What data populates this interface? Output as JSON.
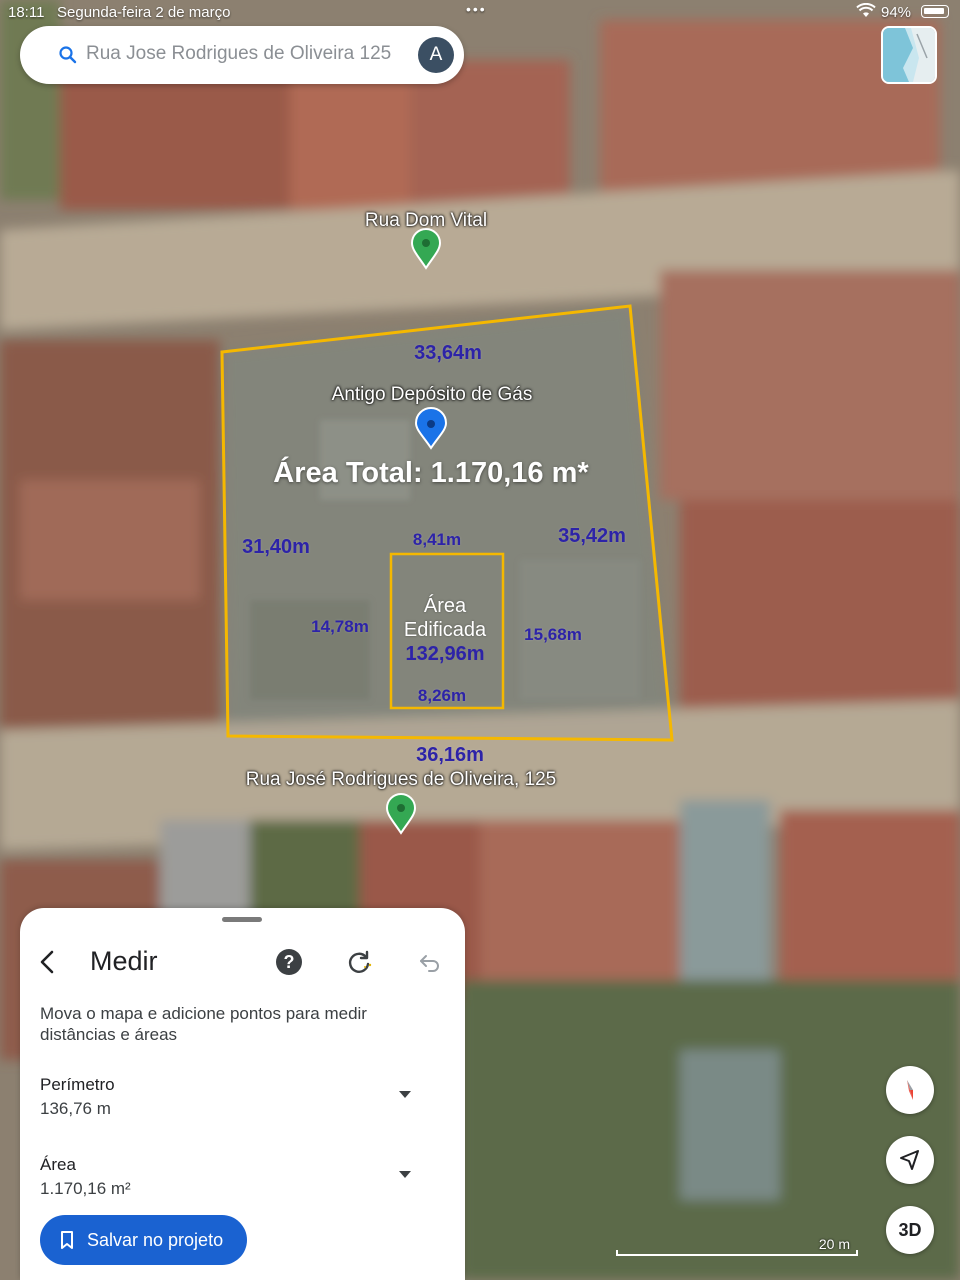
{
  "status_bar": {
    "time": "18:11",
    "date": "Segunda-feira 2 de março",
    "battery": "94%"
  },
  "search": {
    "text": "Rua Jose Rodrigues de Oliveira 125",
    "avatar_letter": "A"
  },
  "map": {
    "street_top": "Rua Dom Vital",
    "place": "Antigo Depósito de Gás",
    "total_area": "Área Total: 1.170,16 m*",
    "sides": {
      "top": "33,64m",
      "left": "31,40m",
      "right": "35,42m",
      "bottom": "36,16m"
    },
    "built": {
      "title_line1": "Área",
      "title_line2": "Edificada",
      "area": "132,96m",
      "top": "8,41m",
      "left": "14,78m",
      "right": "15,68m",
      "bottom": "8,26m"
    },
    "street_bottom": "Rua José Rodrigues de Oliveira, 125",
    "scale_label": "20 m",
    "colors": {
      "outline": "#f5b800",
      "measure_text": "#2d23a8",
      "pin_green": "#34a853",
      "pin_blue": "#1a73e8"
    }
  },
  "panel": {
    "title": "Medir",
    "description": "Mova o mapa e adicione pontos para medir distâncias e áreas",
    "perimeter_label": "Perímetro",
    "perimeter_value": "136,76 m",
    "area_label": "Área",
    "area_value": "1.170,16 m²",
    "save_label": "Salvar no projeto",
    "help_glyph": "?"
  },
  "controls": {
    "three_d": "3D",
    "icons": [
      "compass-icon",
      "my-location-icon",
      "3d-toggle"
    ]
  }
}
